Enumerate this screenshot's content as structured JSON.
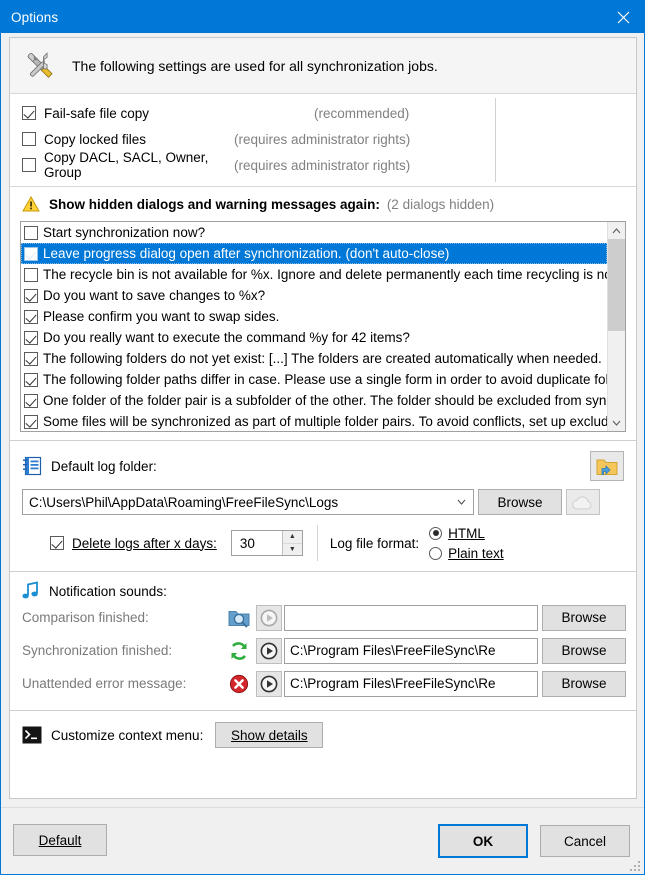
{
  "window": {
    "title": "Options",
    "close_icon": "close-icon"
  },
  "header": {
    "icon": "tools-icon",
    "text": "The following settings are used for all synchronization jobs."
  },
  "copy_options": [
    {
      "label": "Fail-safe file copy",
      "hint": "(recommended)",
      "checked": true
    },
    {
      "label": "Copy locked files",
      "hint": "(requires administrator rights)",
      "checked": false
    },
    {
      "label": "Copy DACL, SACL, Owner, Group",
      "hint": "(requires administrator rights)",
      "checked": false
    }
  ],
  "hidden_dialogs": {
    "icon": "warning-icon",
    "label": "Show hidden dialogs and warning messages again:",
    "count_text": "(2 dialogs hidden)",
    "items": [
      {
        "text": "Start synchronization now?",
        "checked": false,
        "selected": false
      },
      {
        "text": "Leave progress dialog open after synchronization. (don't auto-close)",
        "checked": true,
        "selected": true
      },
      {
        "text": "The recycle bin is not available for %x. Ignore and delete permanently each time recycling is not available?",
        "checked": false,
        "selected": false
      },
      {
        "text": "Do you want to save changes to %x?",
        "checked": true,
        "selected": false
      },
      {
        "text": "Please confirm you want to swap sides.",
        "checked": true,
        "selected": false
      },
      {
        "text": "Do you really want to execute the command %y for 42 items?",
        "checked": true,
        "selected": false
      },
      {
        "text": "The following folders do not yet exist: [...] The folders are created automatically when needed.",
        "checked": true,
        "selected": false
      },
      {
        "text": "The following folder paths differ in case. Please use a single form in order to avoid duplicate folders.",
        "checked": true,
        "selected": false
      },
      {
        "text": "One folder of the folder pair is a subfolder of the other. The folder should be excluded from synchronization via filter.",
        "checked": true,
        "selected": false
      },
      {
        "text": "Some files will be synchronized as part of multiple folder pairs. To avoid conflicts, set up exclude filters.",
        "checked": true,
        "selected": false
      }
    ],
    "scrollbar": {
      "up_arrow": "chevron-up-icon",
      "down_arrow": "chevron-down-icon"
    }
  },
  "log_folder": {
    "icon": "log-book-icon",
    "label": "Default log folder:",
    "path_value": "C:\\Users\\Phil\\AppData\\Roaming\\FreeFileSync\\Logs",
    "dropdown_icon": "chevron-down-icon",
    "browse_label": "Browse",
    "folder_button_icon": "folder-icon",
    "cloud_button_icon": "cloud-icon",
    "delete_logs": {
      "label": "Delete logs after x days:",
      "checked": true,
      "value": "30",
      "spin_up_icon": "spin-up-icon",
      "spin_down_icon": "spin-down-icon"
    },
    "log_file_format": {
      "label": "Log file format:",
      "options": [
        {
          "label": "HTML",
          "selected": true
        },
        {
          "label": "Plain text",
          "selected": false
        }
      ]
    }
  },
  "notification_sounds": {
    "icon": "music-note-icon",
    "title": "Notification sounds:",
    "rows": [
      {
        "label": "Comparison finished:",
        "status_icon": "compare-folder-icon",
        "play_icon": "play-icon",
        "play_enabled": false,
        "value": "",
        "browse_label": "Browse"
      },
      {
        "label": "Synchronization finished:",
        "status_icon": "sync-arrows-icon",
        "play_icon": "play-icon",
        "play_enabled": true,
        "value": "C:\\Program Files\\FreeFileSync\\Re",
        "browse_label": "Browse"
      },
      {
        "label": "Unattended error message:",
        "status_icon": "error-icon",
        "play_icon": "play-icon",
        "play_enabled": true,
        "value": "C:\\Program Files\\FreeFileSync\\Re",
        "browse_label": "Browse"
      }
    ]
  },
  "context_menu": {
    "icon": "console-icon",
    "label": "Customize context menu:",
    "button_label": "Show details"
  },
  "footer": {
    "default_label": "Default",
    "ok_label": "OK",
    "cancel_label": "Cancel",
    "resize_grip": "resize-grip-icon"
  },
  "colors": {
    "accent": "#0078d7",
    "selection": "#0078d7",
    "hint_text": "#808080",
    "dialog_bg": "#f0f0f0"
  }
}
